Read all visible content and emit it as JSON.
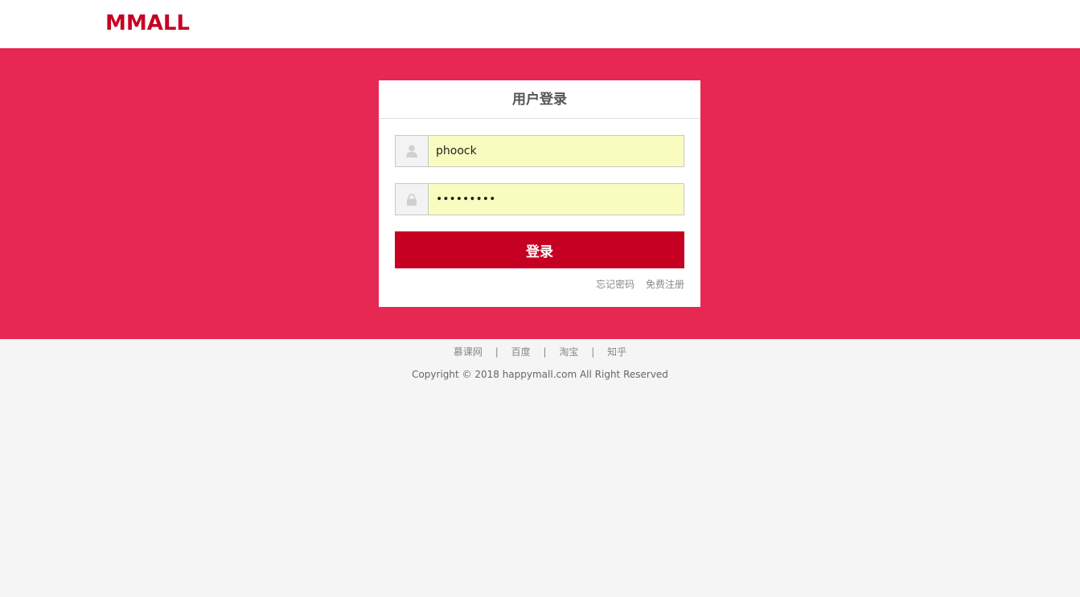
{
  "header": {
    "logo": "MMALL"
  },
  "login": {
    "title": "用户登录",
    "username": {
      "icon": "user-icon",
      "value": "phoock"
    },
    "password": {
      "icon": "lock-icon",
      "value": "•••••••••"
    },
    "submit_label": "登录",
    "forgot_label": "忘记密码",
    "register_label": "免费注册"
  },
  "footer": {
    "links": [
      "慕课网",
      "百度",
      "淘宝",
      "知乎"
    ],
    "separator": "|",
    "copyright": "Copyright © 2018 happymall.com All Right Reserved"
  },
  "colors": {
    "brand": "#c60023",
    "banner": "#e62853",
    "input_autofill": "#f9fcbf",
    "page_bg": "#f5f5f5"
  }
}
